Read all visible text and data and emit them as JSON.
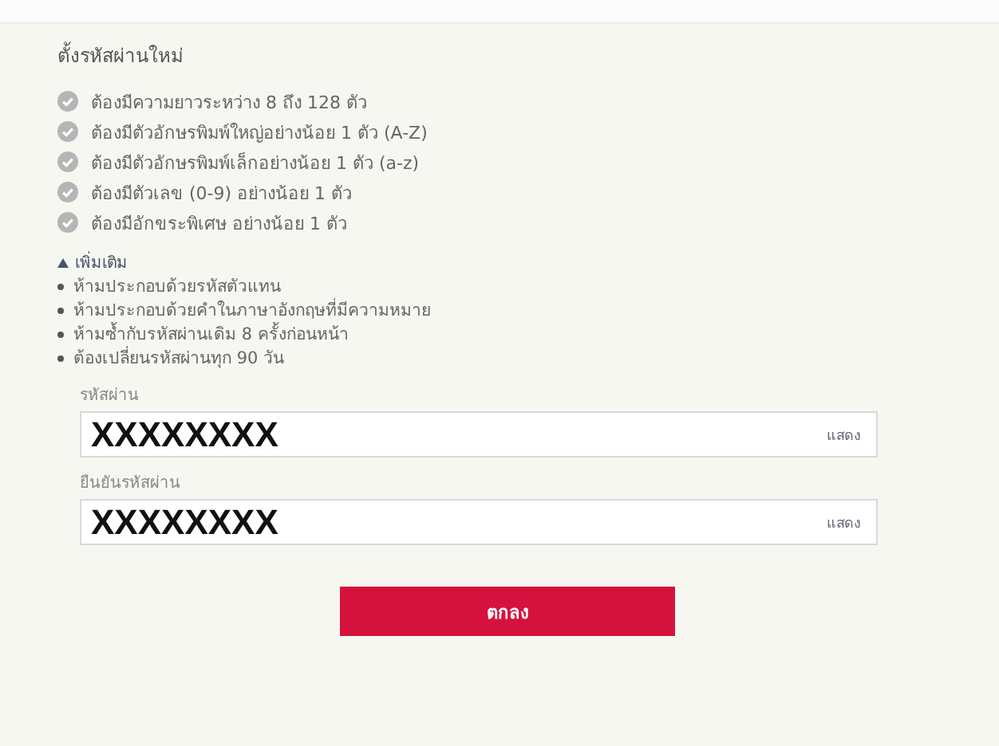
{
  "title": "ตั้งรหัสผ่านใหม่",
  "requirements": [
    "ต้องมีความยาวระหว่าง 8 ถึง 128 ตัว",
    "ต้องมีตัวอักษรพิมพ์ใหญ่อย่างน้อย 1 ตัว (A-Z)",
    "ต้องมีตัวอักษรพิมพ์เล็กอย่างน้อย 1 ตัว (a-z)",
    "ต้องมีตัวเลข (0-9) อย่างน้อย 1 ตัว",
    "ต้องมีอักขระพิเศษ อย่างน้อย 1 ตัว"
  ],
  "more": {
    "label": "เพิ่มเติม",
    "expanded": true,
    "items": [
      "ห้ามประกอบด้วยรหัสตัวแทน",
      "ห้ามประกอบด้วยคำในภาษาอังกฤษที่มีความหมาย",
      "ห้ามซ้ำกับรหัสผ่านเดิม 8 ครั้งก่อนหน้า",
      "ต้องเปลี่ยนรหัสผ่านทุก 90 วัน"
    ]
  },
  "fields": [
    {
      "label": "รหัสผ่าน",
      "value": "XXXXXXXX",
      "toggle": "แสดง"
    },
    {
      "label": "ยืนยันรหัสผ่าน",
      "value": "XXXXXXXX",
      "toggle": "แสดง"
    }
  ],
  "submit": "ตกลง"
}
